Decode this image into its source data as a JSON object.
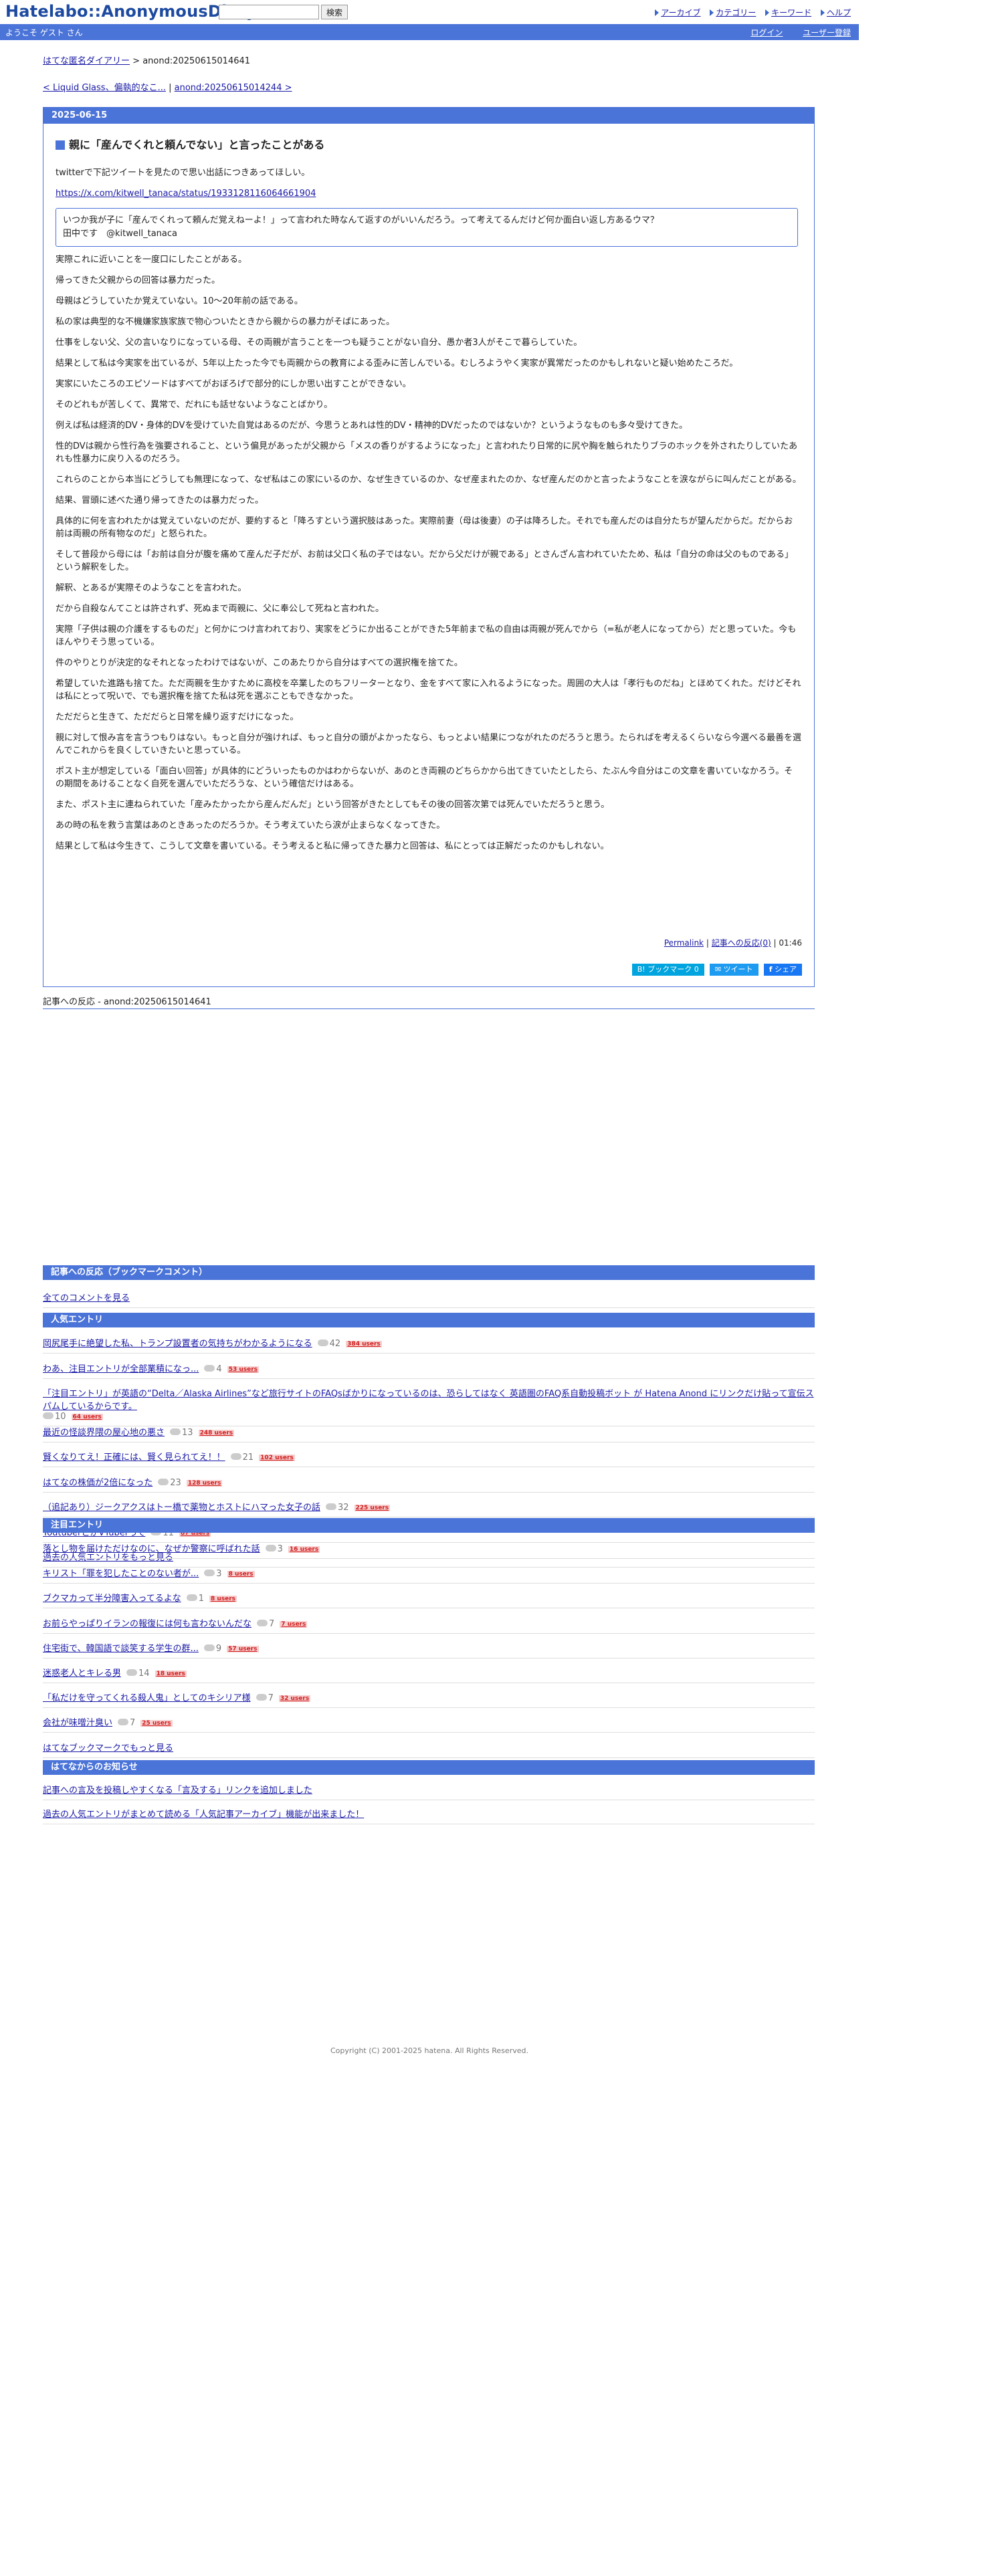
{
  "header": {
    "logo": "Hatelabo::AnonymousDiary",
    "search_placeholder": "",
    "search_button": "検索",
    "nav": [
      "アーカイブ",
      "カテゴリー",
      "キーワード",
      "ヘルプ"
    ]
  },
  "user_bar": {
    "welcome": "ようこそ ゲスト さん",
    "login": "ログイン",
    "register": "ユーザー登録"
  },
  "breadcrumb": {
    "home": "はてな匿名ダイアリー",
    "separator": ">",
    "current": "anond:20250615014641"
  },
  "prevnext": {
    "prev": "< Liquid Glass、偏執的なこ...",
    "sep": "|",
    "next": "anond:20250615014244 >"
  },
  "entry": {
    "date": "2025-06-15",
    "title": "親に「産んでくれと頼んでない」と言ったことがある",
    "intro": "twitterで下記ツイートを見たので思い出話につきあってほしい。",
    "link": "https://x.com/kitwell_tanaca/status/1933128116064661904",
    "quote_line1": "いつか我が子に「産んでくれって頼んだ覚えねーよ！」って言われた時なんて返すのがいいんだろう。って考えてるんだけど何か面白い返し方あるウマ？",
    "quote_line2": "田中です　@kitwell_tanaca",
    "paragraphs": [
      "実際これに近いことを一度口にしたことがある。",
      "帰ってきた父親からの回答は暴力だった。",
      "母親はどうしていたか覚えていない。10〜20年前の話である。",
      "私の家は典型的な不機嫌家族家族で物心ついたときから親からの暴力がそばにあった。",
      "仕事をしない父、父の言いなりになっている母、その両親が言うことを一つも疑うことがない自分、愚か者3人がそこで暮らしていた。",
      "結果として私は今実家を出ているが、5年以上たった今でも両親からの教育による歪みに苦しんでいる。むしろようやく実家が異常だったのかもしれないと疑い始めたころだ。",
      "実家にいたころのエピソードはすべてがおぼろげで部分的にしか思い出すことができない。",
      "そのどれもが苦しくて、異常で、だれにも話せないようなことばかり。",
      "例えば私は経済的DV・身体的DVを受けていた自覚はあるのだが、今思うとあれは性的DV・精神的DVだったのではないか？というようなものも多々受けてきた。",
      "性的DVは親から性行為を強要されること、という偏見があったが父親から「メスの香りがするようになった」と言われたり日常的に尻や胸を触られたりブラのホックを外されたりしていたあれも性暴力に戻り入るのだろう。",
      "これらのことから本当にどうしても無理になって、なぜ私はこの家にいるのか、なぜ生きているのか、なぜ産まれたのか、なぜ産んだのかと言ったようなことを涙ながらに叫んだことがある。",
      "結果、冒頭に述べた通り帰ってきたのは暴力だった。",
      "具体的に何を言われたかは覚えていないのだが、要約すると「降ろすという選択肢はあった。実際前妻（母は後妻）の子は降ろした。それでも産んだのは自分たちが望んだからだ。だからお前は両親の所有物なのだ」と怒られた。",
      "そして普段から母には「お前は自分が腹を痛めて産んだ子だが、お前は父口く私の子ではない。だから父だけが親である」とさんざん言われていたため、私は「自分の命は父のものである」という解釈をした。",
      "解釈、とあるが実際そのようなことを言われた。",
      "だから自殺なんてことは許されず、死ぬまで両親に、父に奉公して死ねと言われた。",
      "実際「子供は親の介護をするものだ」と何かにつけ言われており、実家をどうにか出ることができた5年前まで私の自由は両親が死んでから（=私が老人になってから）だと思っていた。今もほんやりそう思っている。",
      "件のやりとりが決定的なそれとなったわけではないが、このあたりから自分はすべての選択権を捨てた。",
      "希望していた進路も捨てた。ただ両親を生かすために高校を卒業したのちフリーターとなり、金をすべて家に入れるようになった。周囲の大人は「孝行ものだね」とほめてくれた。だけどそれは私にとって呪いで、でも選択権を捨てた私は死を選ぶこともできなかった。",
      "ただだらと生きて、ただだらと日常を繰り返すだけになった。",
      "親に対して恨み言を言うつもりはない。もっと自分が強ければ、もっと自分の頭がよかったなら、もっとよい結果につながれたのだろうと思う。たらればを考えるくらいなら今選べる最善を選んでこれからを良くしていきたいと思っている。",
      "ポスト主が想定している「面白い回答」が具体的にどういったものかはわからないが、あのとき両親のどちらかから出てきていたとしたら、たぶん今自分はこの文章を書いていなかろう。その期間をあけることなく自死を選んでいただろうな、という確信だけはある。",
      "また、ポスト主に連ねられていた「産みたかったから産んだんだ」という回答がきたとしてもその後の回答次第では死んでいただろうと思う。",
      "あの時の私を救う言葉はあのときあったのだろうか。そう考えていたら涙が止まらなくなってきた。",
      "結果として私は今生きて、こうして文章を書いている。そう考えると私に帰ってきた暴力と回答は、私にとっては正解だったのかもしれない。"
    ],
    "footer": {
      "permalink": "Permalink",
      "sep1": "|",
      "comments": "記事への反応(0)",
      "sep2": "|",
      "time": "01:46"
    },
    "share": {
      "hatena": "B! ブックマーク",
      "hatena_count": "0",
      "tweet": "ツイート",
      "fb": "シェア"
    }
  },
  "refer": {
    "label": "記事への反応 -",
    "id": "anond:20250615014641"
  },
  "bookmark_section": {
    "title": "記事への反応（ブックマークコメント）",
    "all_comments": "全てのコメントを見る"
  },
  "popular": {
    "title": "人気エントリ",
    "items": [
      {
        "title": "岡尻尾手に絶望した私、トランプ設置者の気持ちがわかるようになる",
        "count": "42",
        "users": "384 users"
      },
      {
        "title": "わあ、注目エントリが全部業積になっ...",
        "count": "4",
        "users": "53 users"
      },
      {
        "title": "「注目エントリ」が英語の“Delta／Alaska Airlines”など旅行サイトのFAQsばかりになっているのは、恐らしてはなく 英語圏のFAQ系自動投稿ボット が Hatena Anond にリンクだけ貼って宣伝スパムしているからです。",
        "count": "10",
        "users": "64 users"
      },
      {
        "title": "最近の怪談界隈の屋心地の悪さ",
        "count": "13",
        "users": "248 users"
      },
      {
        "title": "賢くなりてえ！正確には、賢く見られてえ！！",
        "count": "21",
        "users": "102 users"
      },
      {
        "title": "はてなの株価が2倍になった",
        "count": "23",
        "users": "128 users"
      },
      {
        "title": "（追記あり）ジークアクスはトー橋で薬物とホストにハマった女子の話",
        "count": "32",
        "users": "225 users"
      },
      {
        "title": "YoutuberとかVTuberって",
        "count": "11",
        "users": "87 users"
      }
    ],
    "more": "過去の人気エントリをもっと見る"
  },
  "hot": {
    "title": "注目エントリ",
    "items": [
      {
        "title": "落とし物を届けただけなのに、なぜか警察に呼ばれた話",
        "count": "3",
        "users": "16 users"
      },
      {
        "title": "キリスト「罪を犯したことのない者が...",
        "count": "3",
        "users": "8 users"
      },
      {
        "title": "ブクマカって半分障害入ってるよな",
        "count": "1",
        "users": "8 users"
      },
      {
        "title": "お前らやっぱりイランの報復には何も言わないんだな",
        "count": "7",
        "users": "7 users"
      },
      {
        "title": "住宅街で、韓国語で談笑する学生の群...",
        "count": "9",
        "users": "57 users"
      },
      {
        "title": "迷惑老人とキレる男",
        "count": "14",
        "users": "18 users"
      },
      {
        "title": "「私だけを守ってくれる殺人鬼」としてのキシリア様",
        "count": "7",
        "users": "32 users"
      },
      {
        "title": "会社が味噌汁臭い",
        "count": "7",
        "users": "25 users"
      }
    ],
    "more": "はてなブックマークでもっと見る"
  },
  "notice": {
    "title": "はてなからのお知らせ",
    "items": [
      "記事への言及を投稿しやすくなる「言及する」リンクを追加しました",
      "過去の人気エントリがまとめて読める「人気記事アーカイブ」機能が出来ました！"
    ]
  },
  "copyright": "Copyright (C) 2001-2025 hatena. All Rights Reserved.",
  "colors": {
    "accent": "#4b74d9",
    "logo": "#1d4aa0",
    "users_badge": "#d21f1f"
  }
}
